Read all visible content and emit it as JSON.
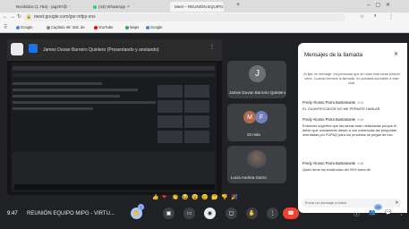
{
  "browser": {
    "tabs": [
      {
        "label": "Recibidos (1.754) - jagz97@"
      },
      {
        "label": "(43) WhatsApp"
      },
      {
        "label": "Meet – REUNIÓN EQUIPO"
      }
    ],
    "new_tab": "+",
    "url": "meet.google.com/gsr-mfpy-xox",
    "bookmarks": [
      {
        "label": "Google"
      },
      {
        "label": "Capítulo 46: Sist. de"
      },
      {
        "label": "YouTube"
      },
      {
        "label": "Maps"
      },
      {
        "label": "Google"
      }
    ]
  },
  "presentation": {
    "presenter": "James Duvan Barreiro Quintero (Presentando y anotando)"
  },
  "tiles": [
    {
      "name": "James Duvan Barreiro Quintero",
      "initial": "J",
      "color": "#6d6f73"
    },
    {
      "name": "20 más",
      "initials": [
        "M",
        "F"
      ],
      "colors": [
        "#b06a4c",
        "#6f7fbf"
      ]
    },
    {
      "name": "Lucia Andrea Garzo",
      "color": "#4a4d52"
    }
  ],
  "chat": {
    "title": "Mensajes de la llamada",
    "close": "✕",
    "info": "Al fijar un mensaje, los personas que se unan más tarde podrán verlo. Cuando termine la llamada, no quedará accesible a este chat.",
    "messages": [
      {
        "sender": "Fredy Alonso Parra Bustamante",
        "time": "9:44",
        "text": "EL CUANTIFICADOR NO ME PERMITE HABLAR"
      },
      {
        "sender": "Fredy Alonso Parra Bustamante",
        "time": "9:45",
        "text": "Entonces sugeriría que las tareas sean redactadas porque el deber que únicamente dieran a con evidencias las preguntas orientadas por FUPAQ para los procesos se pegan de eso"
      },
      {
        "sender": "Fredy Alonso Parra Bustamante",
        "time": "9:46",
        "text": "Quien tiene los evidencias del 93% fuera de"
      }
    ],
    "input_placeholder": "Envía un mensaje a todos",
    "send_icon": "➤"
  },
  "footer": {
    "time": "9:47",
    "meeting_name": "REUNIÓN EQUIPO MIPG - VIRTU...",
    "reactions": [
      "👍",
      "❤",
      "👏",
      "😂",
      "😮",
      "😢",
      "🤔",
      "👎",
      "🎉"
    ],
    "hand_badge": "2",
    "people_badge": "23",
    "info_icon": "ⓘ",
    "people_icon": "👥",
    "chat_icon": "💬",
    "more_icon": "⋮"
  }
}
